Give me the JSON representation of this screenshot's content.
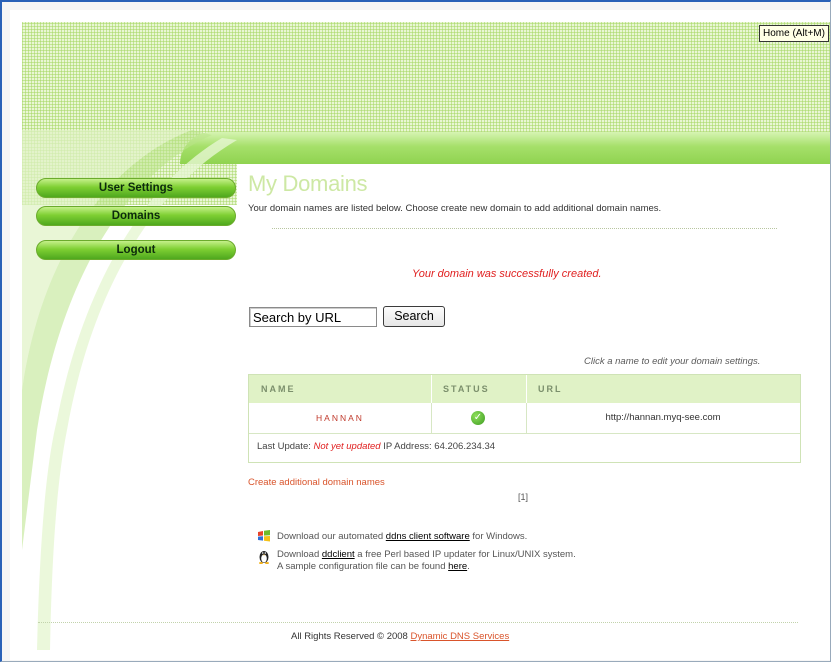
{
  "tooltip": "Home (Alt+M)",
  "nav": {
    "user_settings": "User Settings",
    "domains": "Domains",
    "logout": "Logout"
  },
  "page": {
    "title": "My Domains",
    "description": "Your domain names are listed below. Choose create new domain to add additional domain names.",
    "success_message": "Your domain was successfully created."
  },
  "search": {
    "value": "Search by URL",
    "button_label": "Search"
  },
  "hint": "Click a name to edit your domain settings.",
  "table": {
    "headers": {
      "name": "NAME",
      "status": "STATUS",
      "url": "URL"
    },
    "rows": [
      {
        "name": "HANNAN",
        "status": "ok",
        "url": "http://hannan.myq-see.com"
      }
    ],
    "last_update_label": "Last Update:",
    "last_update_value": "Not yet updated",
    "ip_address": "IP Address: 64.206.234.34"
  },
  "create_link": "Create additional domain names",
  "pager": "[1]",
  "downloads": {
    "windows_prefix": "Download our automated",
    "windows_link": "ddns client software",
    "windows_suffix": "for Windows.",
    "linux_prefix": "Download",
    "linux_link": "ddclient",
    "linux_suffix": "a free Perl based IP updater for Linux/UNIX system.",
    "sample_prefix": "A sample configuration file can be found",
    "sample_link": "here",
    "sample_suffix": "."
  },
  "footer": {
    "text": "All Rights Reserved © 2008",
    "link": "Dynamic DNS Services"
  },
  "colors": {
    "accent_green": "#7fcf33",
    "error_red": "#e02020",
    "link_orange": "#d9542b"
  }
}
